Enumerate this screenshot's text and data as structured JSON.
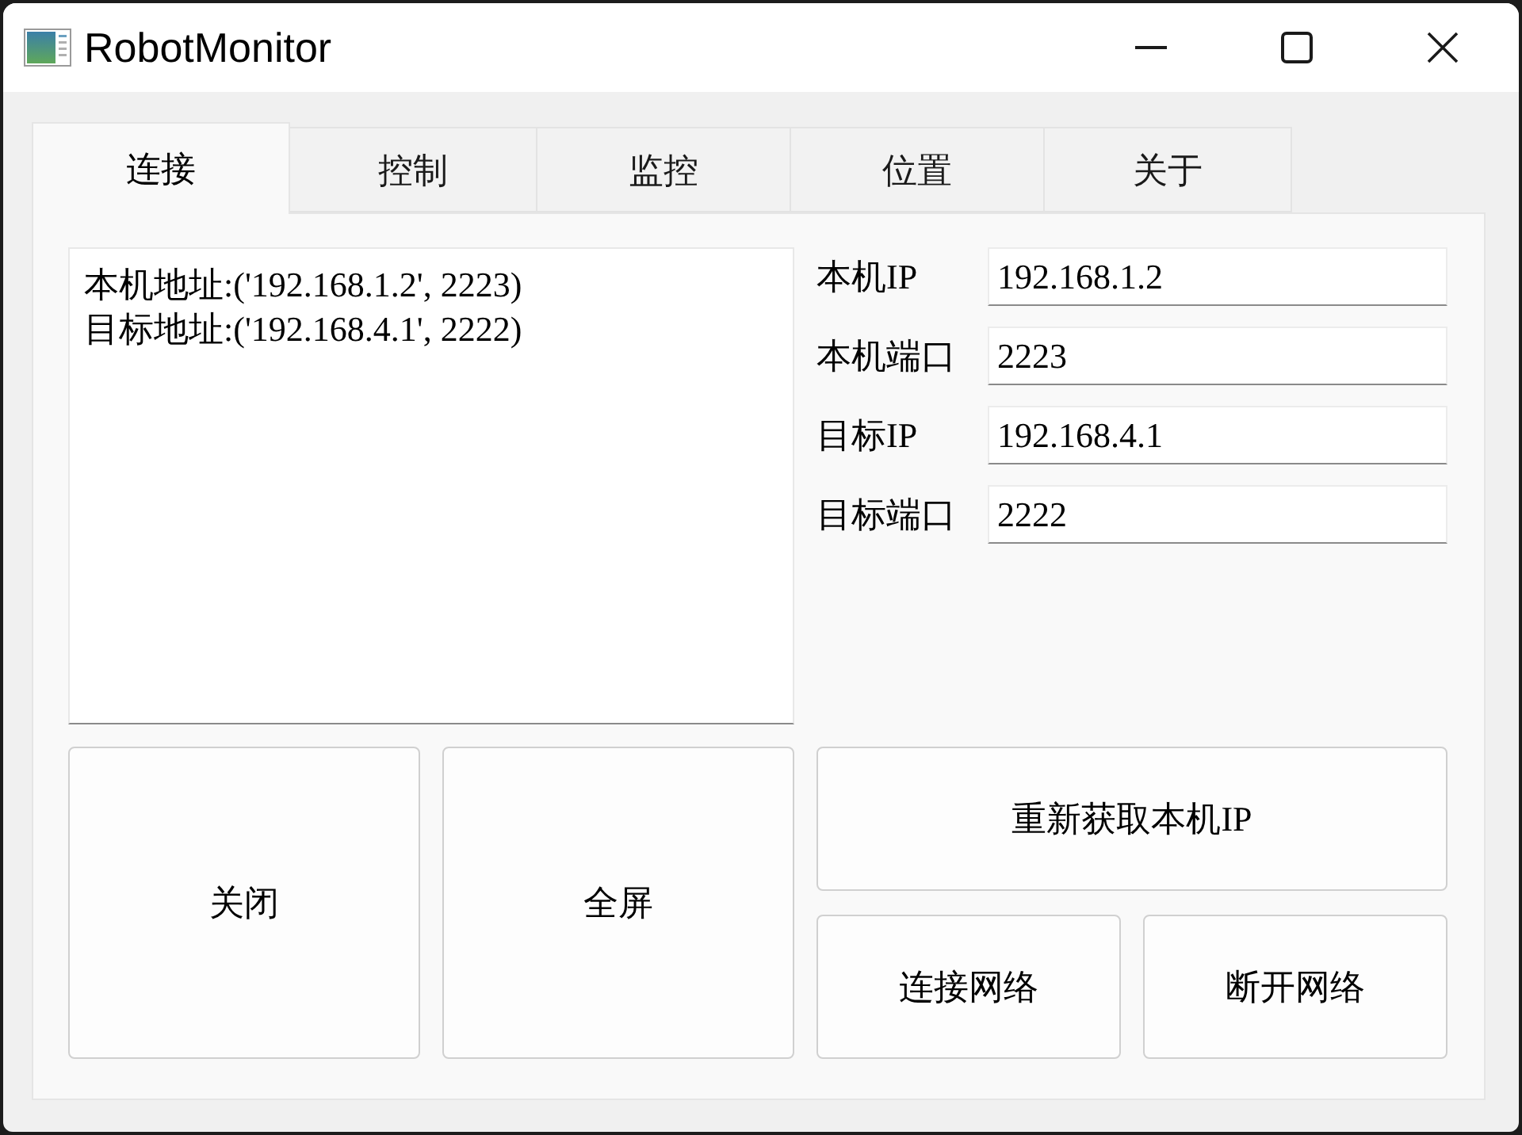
{
  "window": {
    "title": "RobotMonitor"
  },
  "tabs": [
    {
      "label": "连接",
      "selected": true
    },
    {
      "label": "控制",
      "selected": false
    },
    {
      "label": "监控",
      "selected": false
    },
    {
      "label": "位置",
      "selected": false
    },
    {
      "label": "关于",
      "selected": false
    }
  ],
  "log": {
    "lines": [
      "本机地址:('192.168.1.2', 2223)",
      "目标地址:('192.168.4.1', 2222)"
    ]
  },
  "fields": [
    {
      "label": "本机IP",
      "value": "192.168.1.2"
    },
    {
      "label": "本机端口",
      "value": "2223"
    },
    {
      "label": "目标IP",
      "value": "192.168.4.1"
    },
    {
      "label": "目标端口",
      "value": "2222"
    }
  ],
  "buttons": [
    "关闭",
    "全屏",
    "重新获取本机IP",
    "连接网络",
    "断开网络"
  ]
}
